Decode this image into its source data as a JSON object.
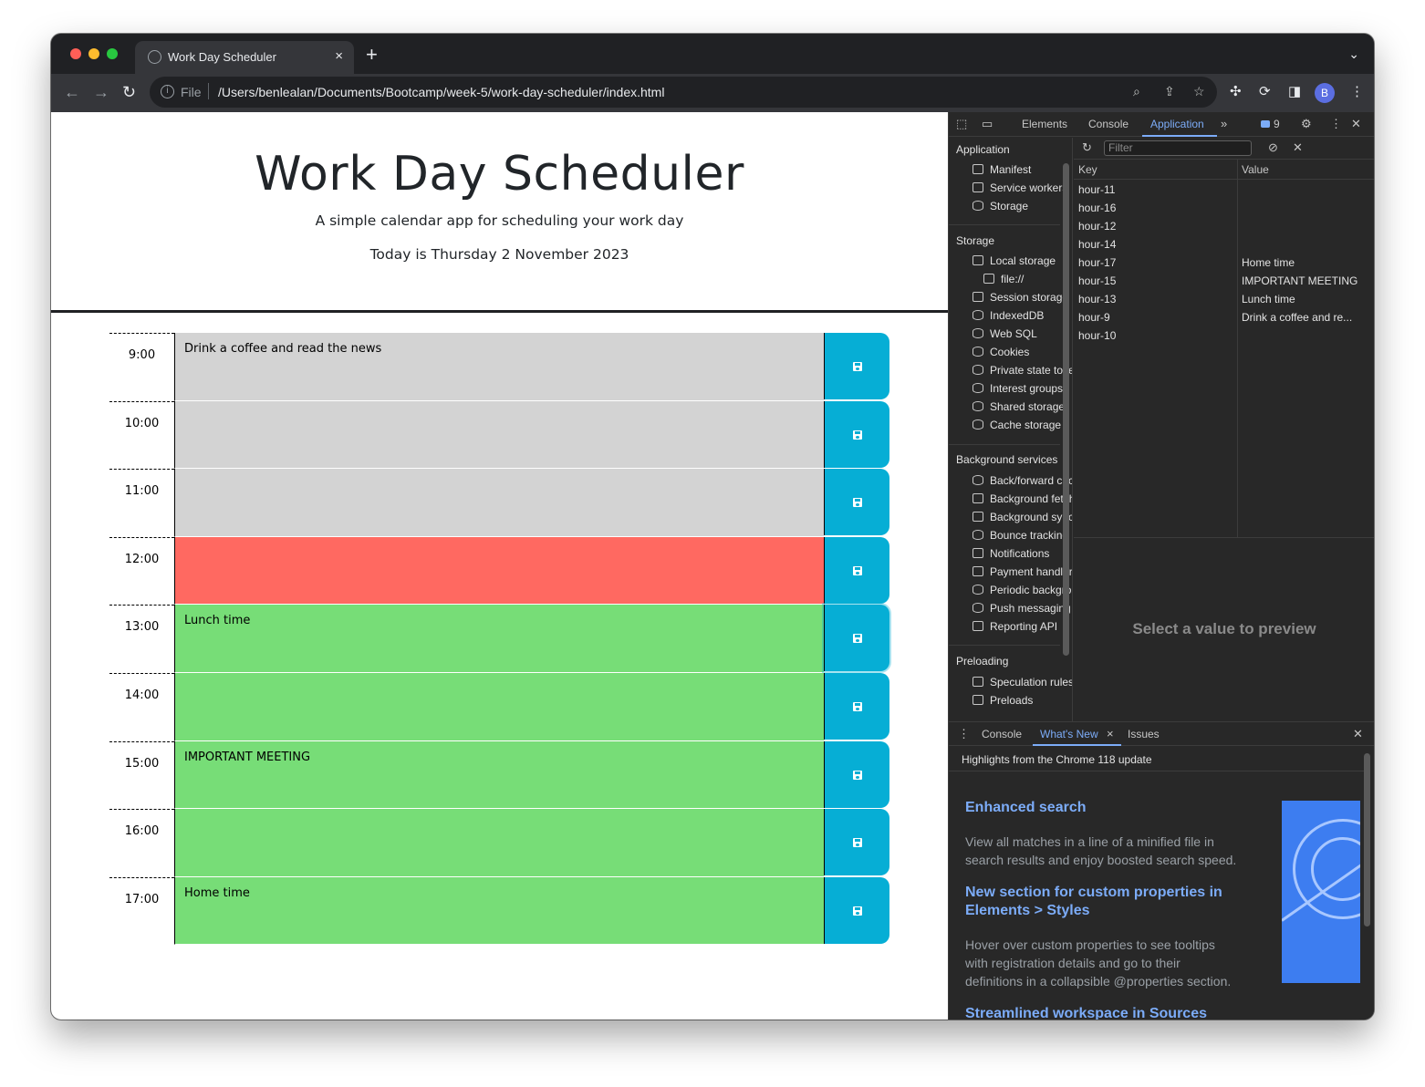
{
  "browser": {
    "tab_title": "Work Day Scheduler",
    "scheme": "File",
    "url": "/Users/benlealan/Documents/Bootcamp/week-5/work-day-scheduler/index.html",
    "avatar_letter": "B"
  },
  "page": {
    "title": "Work Day Scheduler",
    "lead": "A simple calendar app for scheduling your work day",
    "today": "Today is Thursday 2 November 2023",
    "rows": [
      {
        "hour": "9:00",
        "text": "Drink a coffee and read the news",
        "state": "past"
      },
      {
        "hour": "10:00",
        "text": "",
        "state": "past"
      },
      {
        "hour": "11:00",
        "text": "",
        "state": "past"
      },
      {
        "hour": "12:00",
        "text": "",
        "state": "present"
      },
      {
        "hour": "13:00",
        "text": "Lunch time",
        "state": "future"
      },
      {
        "hour": "14:00",
        "text": "",
        "state": "future"
      },
      {
        "hour": "15:00",
        "text": "IMPORTANT MEETING",
        "state": "future"
      },
      {
        "hour": "16:00",
        "text": "",
        "state": "future"
      },
      {
        "hour": "17:00",
        "text": "Home time",
        "state": "future"
      }
    ],
    "colors": {
      "past": "#d3d3d3",
      "present": "#ff6961",
      "future": "#77dd77",
      "save": "#06aed5"
    }
  },
  "devtools": {
    "tabs": [
      "Elements",
      "Console",
      "Application"
    ],
    "active_tab": "Application",
    "issues_count": "9",
    "sidebar": {
      "application_title": "Application",
      "application_items": [
        "Manifest",
        "Service workers",
        "Storage"
      ],
      "storage_title": "Storage",
      "storage_items": [
        "Local storage",
        "file://",
        "Session storage",
        "IndexedDB",
        "Web SQL",
        "Cookies",
        "Private state tokens",
        "Interest groups",
        "Shared storage",
        "Cache storage"
      ],
      "background_title": "Background services",
      "background_items": [
        "Back/forward cache",
        "Background fetch",
        "Background sync",
        "Bounce tracking mitigations",
        "Notifications",
        "Payment handler",
        "Periodic background sync",
        "Push messaging",
        "Reporting API"
      ],
      "preloading_title": "Preloading",
      "preloading_items": [
        "Speculation rules",
        "Preloads"
      ]
    },
    "filter_placeholder": "Filter",
    "table": {
      "key_header": "Key",
      "value_header": "Value",
      "rows": [
        {
          "key": "hour-11",
          "value": ""
        },
        {
          "key": "hour-16",
          "value": ""
        },
        {
          "key": "hour-12",
          "value": ""
        },
        {
          "key": "hour-14",
          "value": ""
        },
        {
          "key": "hour-17",
          "value": "Home time"
        },
        {
          "key": "hour-15",
          "value": "IMPORTANT MEETING"
        },
        {
          "key": "hour-13",
          "value": "Lunch time"
        },
        {
          "key": "hour-9",
          "value": "Drink a coffee and re..."
        },
        {
          "key": "hour-10",
          "value": ""
        }
      ]
    },
    "preview_text": "Select a value to preview",
    "drawer": {
      "tabs": [
        "Console",
        "What's New",
        "Issues"
      ],
      "active_tab": "What's New",
      "highlights": "Highlights from the Chrome 118 update",
      "sections": [
        {
          "heading": "Enhanced search",
          "body": "View all matches in a line of a minified file in search results and enjoy boosted search speed."
        },
        {
          "heading": "New section for custom properties in Elements > Styles",
          "body": "Hover over custom properties to see tooltips with registration details and go to their definitions in a collapsible @properties section."
        },
        {
          "heading": "Streamlined workspace in Sources",
          "body": ""
        }
      ]
    }
  }
}
